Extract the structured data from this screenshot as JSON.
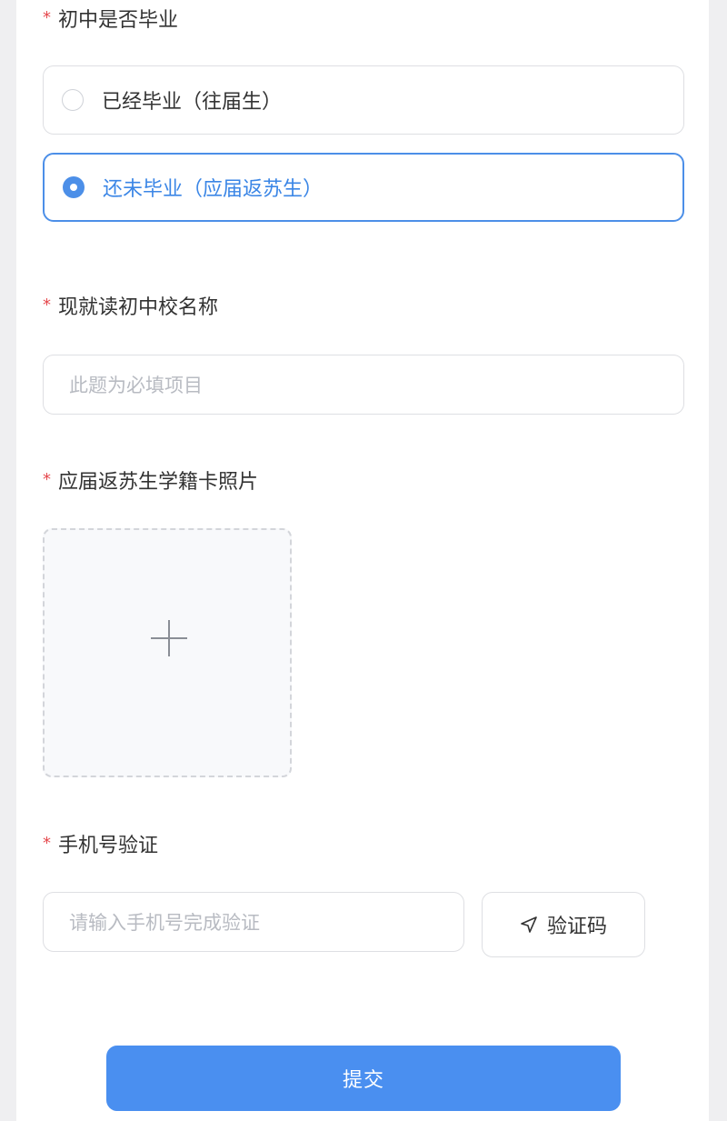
{
  "q_graduated": {
    "required_mark": "*",
    "label": "初中是否毕业",
    "options": [
      {
        "label": "已经毕业（往届生）",
        "selected": false
      },
      {
        "label": "还未毕业（应届返苏生）",
        "selected": true
      }
    ]
  },
  "q_school": {
    "required_mark": "*",
    "label": "现就读初中校名称",
    "placeholder": "此题为必填项目"
  },
  "q_photo": {
    "required_mark": "*",
    "label": "应届返苏生学籍卡照片",
    "upload_icon": "plus-icon"
  },
  "q_phone": {
    "required_mark": "*",
    "label": "手机号验证",
    "placeholder": "请输入手机号完成验证",
    "code_button_label": "验证码",
    "code_button_icon": "send-icon"
  },
  "submit": {
    "label": "提交"
  },
  "colors": {
    "accent": "#4a8ff0",
    "required": "#e5484d",
    "background": "#efeff1"
  }
}
